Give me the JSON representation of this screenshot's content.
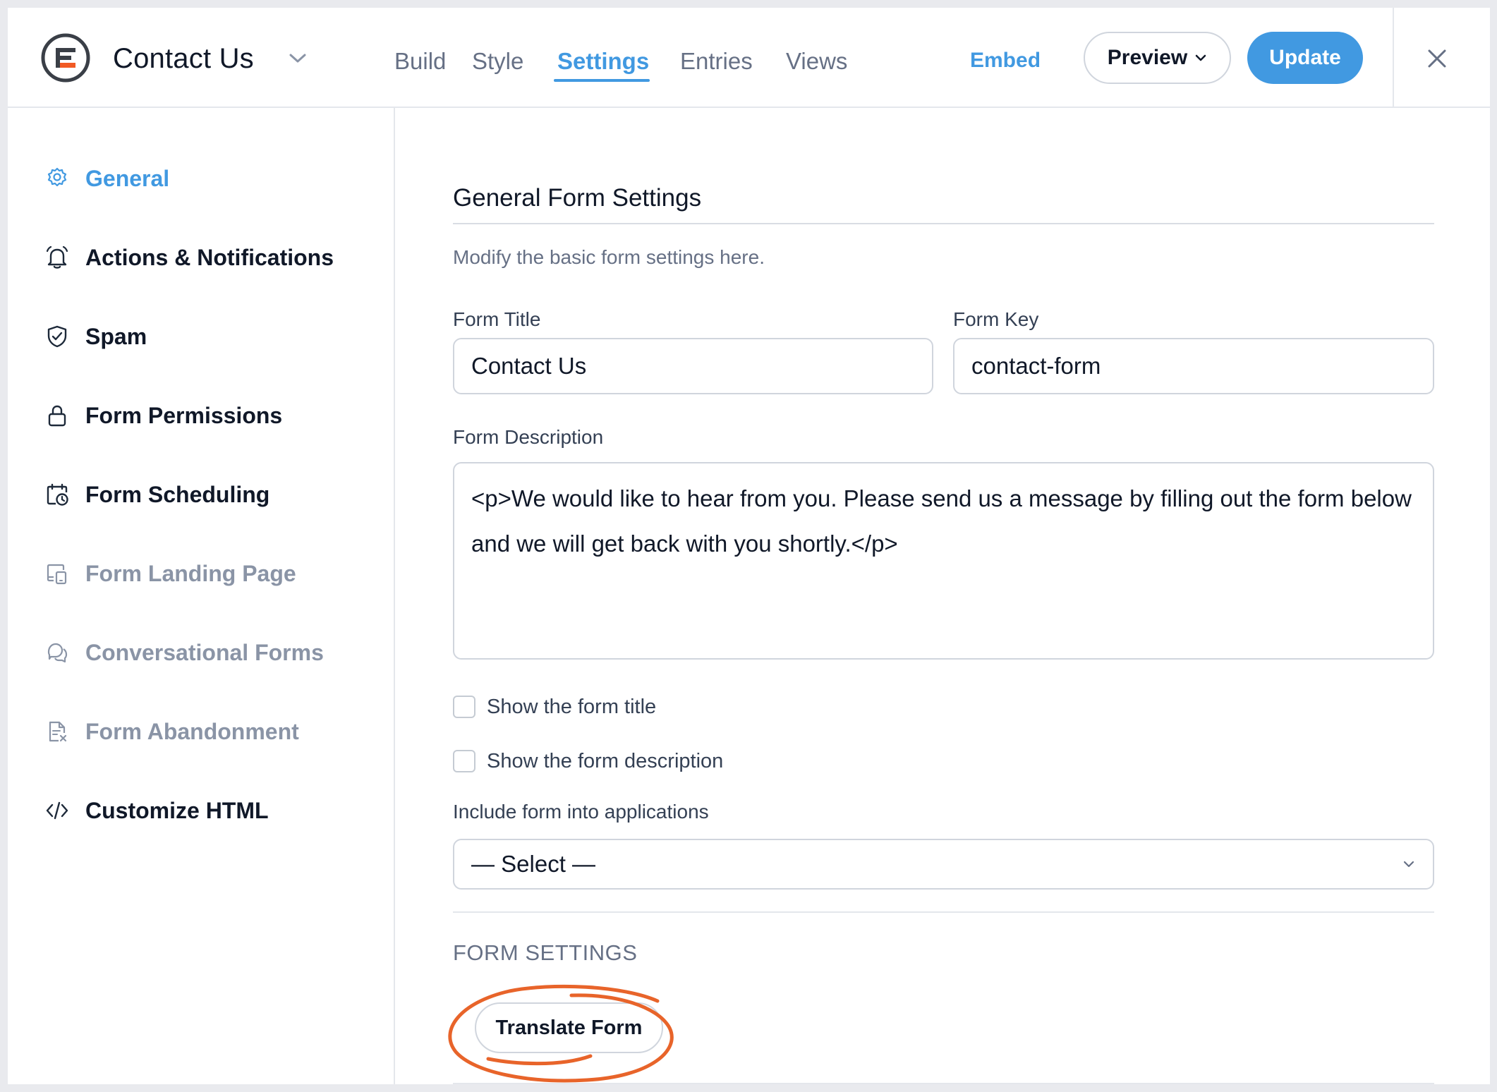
{
  "header": {
    "form_title": "Contact Us",
    "tabs": [
      {
        "label": "Build",
        "active": false
      },
      {
        "label": "Style",
        "active": false
      },
      {
        "label": "Settings",
        "active": true
      },
      {
        "label": "Entries",
        "active": false
      },
      {
        "label": "Views",
        "active": false
      }
    ],
    "embed_label": "Embed",
    "preview_label": "Preview",
    "update_label": "Update"
  },
  "sidebar": {
    "items": [
      {
        "label": "General",
        "icon": "gear-icon",
        "state": "active"
      },
      {
        "label": "Actions & Notifications",
        "icon": "bell-icon",
        "state": "normal"
      },
      {
        "label": "Spam",
        "icon": "shield-check-icon",
        "state": "normal"
      },
      {
        "label": "Form Permissions",
        "icon": "lock-icon",
        "state": "normal"
      },
      {
        "label": "Form Scheduling",
        "icon": "calendar-clock-icon",
        "state": "normal"
      },
      {
        "label": "Form Landing Page",
        "icon": "devices-icon",
        "state": "muted"
      },
      {
        "label": "Conversational Forms",
        "icon": "chat-bubbles-icon",
        "state": "muted"
      },
      {
        "label": "Form Abandonment",
        "icon": "document-x-icon",
        "state": "muted"
      },
      {
        "label": "Customize HTML",
        "icon": "code-icon",
        "state": "normal"
      }
    ]
  },
  "main": {
    "section_title": "General Form Settings",
    "section_description": "Modify the basic form settings here.",
    "form_title_label": "Form Title",
    "form_title_value": "Contact Us",
    "form_key_label": "Form Key",
    "form_key_value": "contact-form",
    "form_description_label": "Form Description",
    "form_description_value": "<p>We would like to hear from you. Please send us a message by filling out the form below and we will get back with you shortly.</p>",
    "show_title_label": "Show the form title",
    "show_title_checked": false,
    "show_description_label": "Show the form description",
    "show_description_checked": false,
    "include_label": "Include form into applications",
    "include_select_value": "— Select —",
    "form_settings_heading": "FORM SETTINGS",
    "translate_button_label": "Translate Form"
  },
  "colors": {
    "accent": "#4199e1",
    "highlight_circle": "#e8642a",
    "logo_orange": "#f15a24"
  }
}
